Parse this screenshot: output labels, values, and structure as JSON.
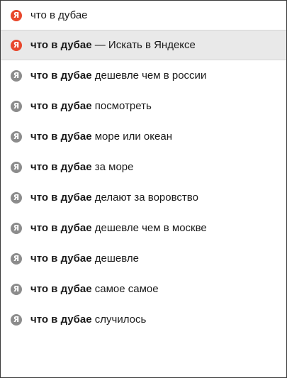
{
  "search": {
    "query": "что в дубае",
    "icon": "yandex-logo-icon",
    "icon_glyph": "Я",
    "icon_color": "#e8472c"
  },
  "suggestions": [
    {
      "bold": "что в дубае",
      "rest": " — Искать в Яндексе",
      "active": true
    },
    {
      "bold": "что в дубае",
      "rest": " дешевле чем в россии",
      "active": false
    },
    {
      "bold": "что в дубае",
      "rest": " посмотреть",
      "active": false
    },
    {
      "bold": "что в дубае",
      "rest": " море или океан",
      "active": false
    },
    {
      "bold": "что в дубае",
      "rest": " за море",
      "active": false
    },
    {
      "bold": "что в дубае",
      "rest": " делают за воровство",
      "active": false
    },
    {
      "bold": "что в дубае",
      "rest": " дешевле чем в москве",
      "active": false
    },
    {
      "bold": "что в дубае",
      "rest": " дешевле",
      "active": false
    },
    {
      "bold": "что в дубае",
      "rest": " самое самое",
      "active": false
    },
    {
      "bold": "что в дубае",
      "rest": " случилось",
      "active": false
    }
  ],
  "colors": {
    "active_icon": "#e8472c",
    "inactive_icon": "#8c8c8c",
    "active_bg": "#e9e9e9"
  }
}
